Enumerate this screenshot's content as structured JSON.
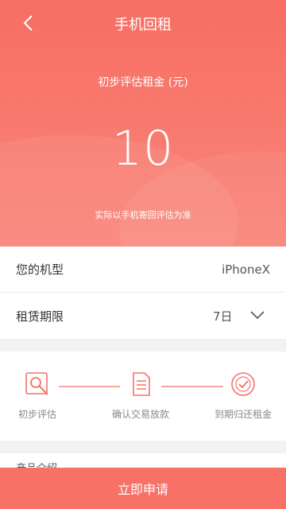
{
  "header": {
    "title": "手机回租",
    "back_icon": "chevron-left-icon"
  },
  "estimate": {
    "label": "初步评估租金 (元)",
    "amount": "10",
    "note": "实际以手机寄回评估为准"
  },
  "info": {
    "model_label": "您的机型",
    "model_value": "iPhoneX",
    "period_label": "租赁期限",
    "period_value": "7日"
  },
  "steps": [
    {
      "label": "初步评估",
      "icon": "magnifier-icon"
    },
    {
      "label": "确认交易放款",
      "icon": "document-icon"
    },
    {
      "label": "到期归还租金",
      "icon": "check-circle-icon"
    }
  ],
  "product": {
    "label": "产品介绍"
  },
  "footer": {
    "apply_label": "立即申请"
  },
  "colors": {
    "accent": "#f77166",
    "step_line": "#f4a79f"
  }
}
